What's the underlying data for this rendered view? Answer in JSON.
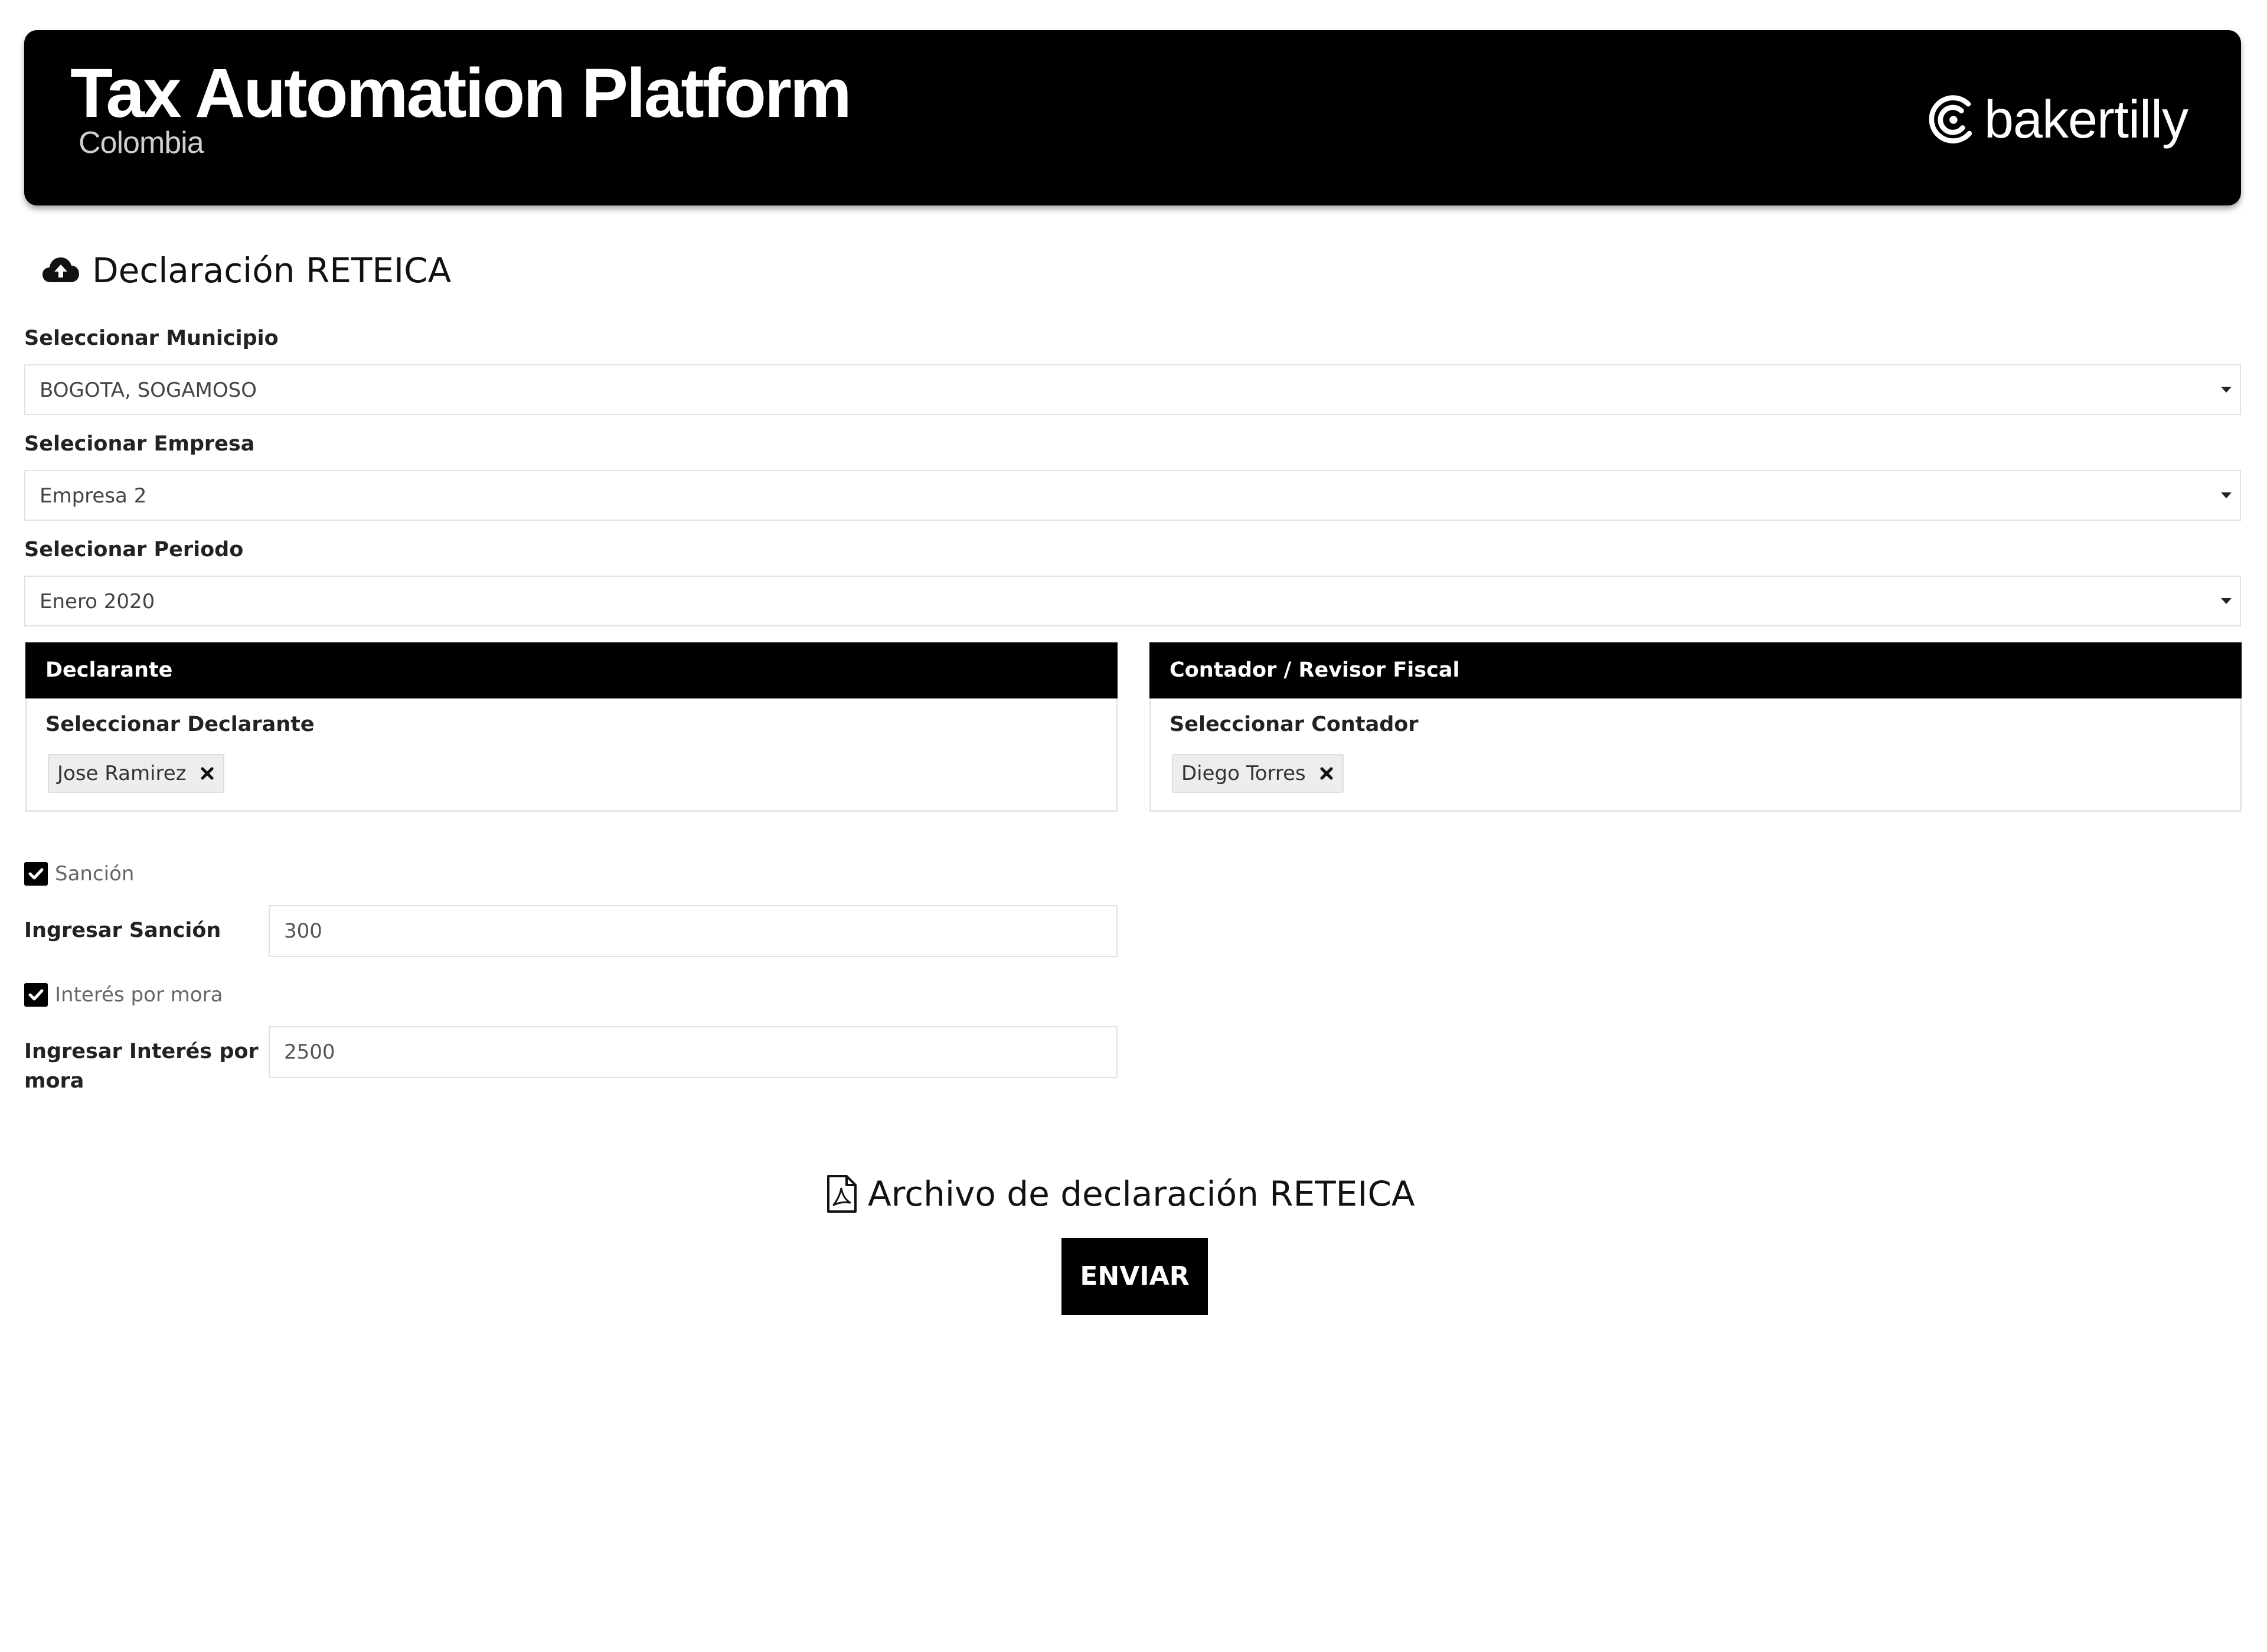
{
  "header": {
    "title": "Tax Automation Platform",
    "subtitle": "Colombia",
    "brand": "bakertilly",
    "brand_icon": "bakertilly-logo-icon"
  },
  "page": {
    "title": "Declaración RETEICA",
    "title_icon": "cloud-upload-icon"
  },
  "form": {
    "municipio": {
      "label": "Seleccionar Municipio",
      "value": "BOGOTA, SOGAMOSO"
    },
    "empresa": {
      "label": "Selecionar Empresa",
      "value": "Empresa 2"
    },
    "periodo": {
      "label": "Selecionar Periodo",
      "value": "Enero 2020"
    }
  },
  "declarante_panel": {
    "header": "Declarante",
    "label": "Seleccionar Declarante",
    "selected": "Jose Ramirez"
  },
  "contador_panel": {
    "header": "Contador / Revisor Fiscal",
    "label": "Seleccionar Contador",
    "selected": "Diego Torres"
  },
  "sancion": {
    "checkbox_label": "Sanción",
    "checked": true,
    "input_label": "Ingresar Sanción",
    "value": "300"
  },
  "interes": {
    "checkbox_label": "Interés por mora",
    "checked": true,
    "input_label": "Ingresar Interés por mora",
    "value": "2500"
  },
  "file_section": {
    "title": "Archivo de declaración RETEICA",
    "title_icon": "pdf-file-icon",
    "button_label": "ENVIAR"
  },
  "colors": {
    "header_bg": "#000000",
    "accent": "#000000",
    "border": "#e2e2e2",
    "tag_bg": "#ededed"
  }
}
